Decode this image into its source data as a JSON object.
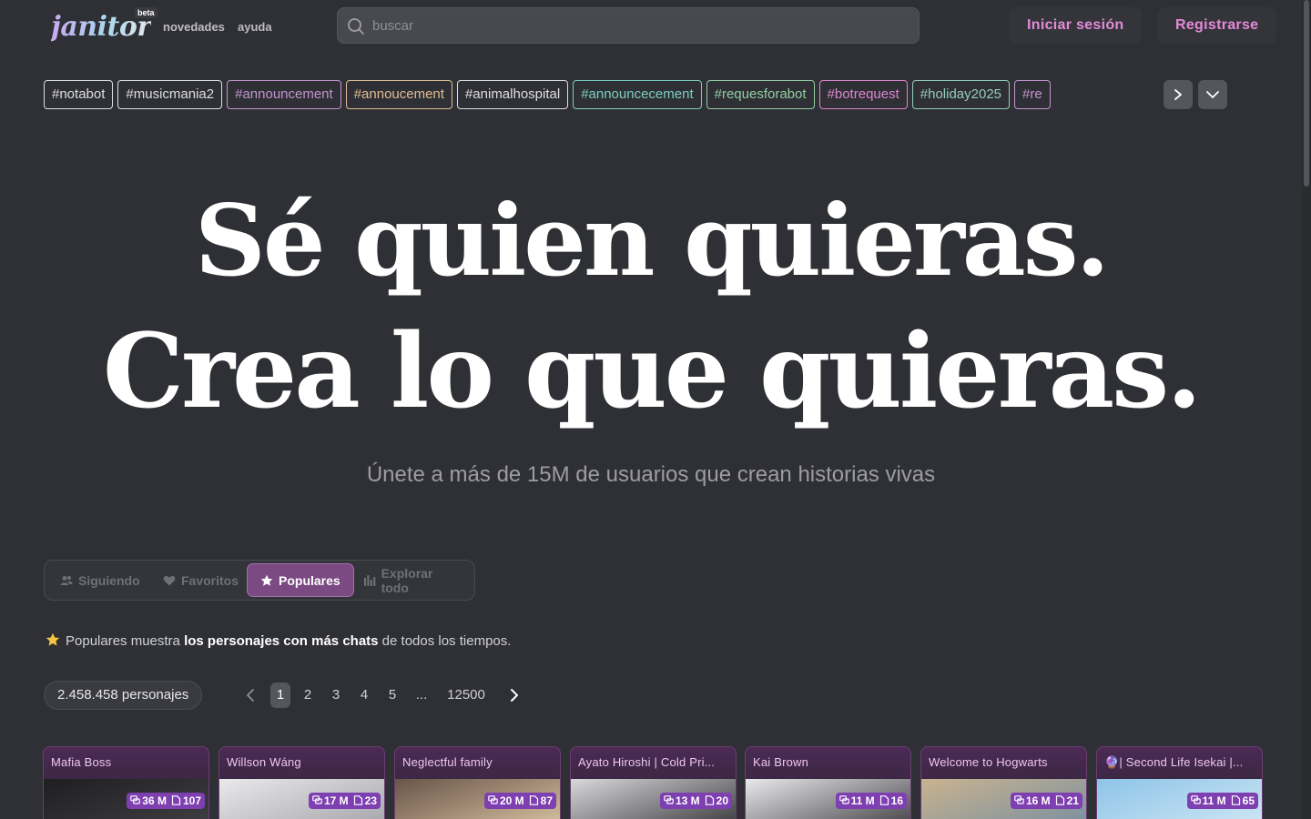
{
  "header": {
    "logo": "janitor",
    "beta": "beta",
    "nav": [
      "novedades",
      "ayuda"
    ],
    "search_placeholder": "buscar",
    "login": "Iniciar sesión",
    "register": "Registrarse"
  },
  "tags": [
    {
      "label": "#notabot",
      "color": "#e8e8ea"
    },
    {
      "label": "#musicmania2",
      "color": "#e8e8ea"
    },
    {
      "label": "#announcement",
      "color": "#c99ad6"
    },
    {
      "label": "#annoucement",
      "color": "#e8c59a"
    },
    {
      "label": "#animalhospital",
      "color": "#e8e8ea"
    },
    {
      "label": "#announcecement",
      "color": "#7fd6c9"
    },
    {
      "label": "#requesforabot",
      "color": "#9ad6a9"
    },
    {
      "label": "#botrequest",
      "color": "#e58ad8"
    },
    {
      "label": "#holiday2025",
      "color": "#9ad6c0"
    },
    {
      "label": "#re",
      "color": "#c99ad6"
    }
  ],
  "hero": {
    "line1": "Sé quien quieras.",
    "line2": "Crea lo que quieras.",
    "subtitle": "Únete a más de 15M de usuarios que crean historias vivas"
  },
  "filters": [
    {
      "label": "Siguiendo",
      "icon": "users-icon",
      "active": false
    },
    {
      "label": "Favoritos",
      "icon": "heart-icon",
      "active": false
    },
    {
      "label": "Populares",
      "icon": "star-icon",
      "active": true
    },
    {
      "label": "Explorar todo",
      "icon": "bars-icon",
      "active": false
    }
  ],
  "info": {
    "prefix": "Populares muestra",
    "bold": "los personajes con más chats",
    "suffix": "de todos los tiempos."
  },
  "pagination": {
    "count": "2.458.458 personajes",
    "pages": [
      "1",
      "2",
      "3",
      "4",
      "5",
      "...",
      "12500"
    ],
    "current": "1"
  },
  "cards": [
    {
      "title": "Mafia Boss",
      "chats": "36 M",
      "messages": "107"
    },
    {
      "title": "Willson Wáng",
      "chats": "17 M",
      "messages": "23"
    },
    {
      "title": "Neglectful family",
      "chats": "20 M",
      "messages": "87"
    },
    {
      "title": "Ayato Hiroshi | Cold Pri...",
      "chats": "13 M",
      "messages": "20"
    },
    {
      "title": "Kai Brown",
      "chats": "11 M",
      "messages": "16"
    },
    {
      "title": "Welcome to Hogwarts",
      "chats": "16 M",
      "messages": "21"
    },
    {
      "title": "🔮| Second Life Isekai |...",
      "chats": "11 M",
      "messages": "65"
    }
  ]
}
